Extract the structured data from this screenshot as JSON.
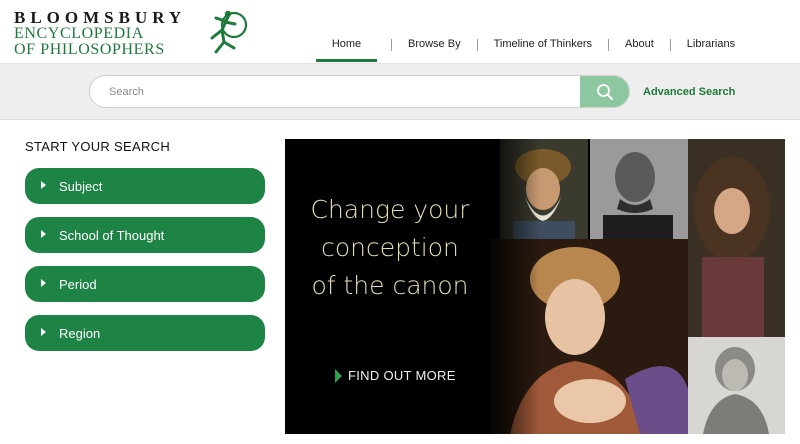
{
  "brand": {
    "line1": "BLOOMSBURY",
    "line2": "ENCYCLOPEDIA",
    "line3": "OF PHILOSOPHERS",
    "logo_icon": "dancing-figure-logo-icon"
  },
  "nav": {
    "items": [
      {
        "label": "Home",
        "active": true
      },
      {
        "label": "Browse By",
        "active": false
      },
      {
        "label": "Timeline of Thinkers",
        "active": false
      },
      {
        "label": "About",
        "active": false
      },
      {
        "label": "Librarians",
        "active": false
      }
    ]
  },
  "search": {
    "placeholder": "Search",
    "value": "",
    "button_icon": "search-icon",
    "advanced_label": "Advanced Search"
  },
  "sidebar": {
    "title": "START YOUR SEARCH",
    "facets": [
      {
        "label": "Subject"
      },
      {
        "label": "School of Thought"
      },
      {
        "label": "Period"
      },
      {
        "label": "Region"
      }
    ]
  },
  "banner": {
    "line1": "Change your",
    "line2": "conception",
    "line3": "of the canon",
    "cta_label": "FIND OUT MORE"
  },
  "colors": {
    "brand_green": "#1d7a3a",
    "facet_green": "#1d8446",
    "search_button": "#8dc79f",
    "banner_text": "#e9dfb6",
    "cta_arrow": "#2ea14a"
  }
}
